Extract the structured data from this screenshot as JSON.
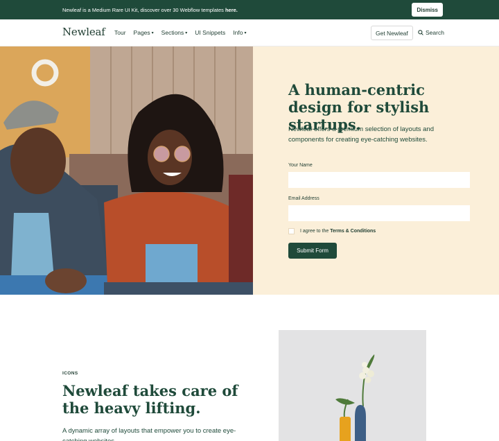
{
  "announcement": {
    "text": "Newleaf is a Medium Rare UI Kit, discover over 30 Webflow templates",
    "link": "here.",
    "dismiss_label": "Dismiss"
  },
  "nav": {
    "logo": "Newleaf",
    "links": [
      {
        "label": "Tour"
      },
      {
        "label": "Pages"
      },
      {
        "label": "Sections"
      },
      {
        "label": "UI Snippets"
      },
      {
        "label": "Info"
      }
    ],
    "cta_label": "Get Newleaf",
    "search_label": "Search"
  },
  "hero": {
    "title": "A human-centric design for stylish startups.",
    "subtitle": "Newleaf offers a premium selection of layouts and components for creating eye-catching websites.",
    "form": {
      "name_label": "Your Name",
      "name_value": "",
      "email_label": "Email Address",
      "email_value": "",
      "agree_prefix": "I agree to the",
      "agree_link": "Terms & Conditions",
      "submit_label": "Submit Form"
    }
  },
  "feature": {
    "eyebrow": "ICONS",
    "title": "Newleaf takes care of the heavy lifting.",
    "body": "A dynamic array of layouts that empower you to create eye-catching websites."
  },
  "colors": {
    "primary": "#1f4a3a",
    "hero_panel": "#fbefd9"
  },
  "icons": {
    "search": "search-icon",
    "caret": "chevron-down-icon"
  }
}
